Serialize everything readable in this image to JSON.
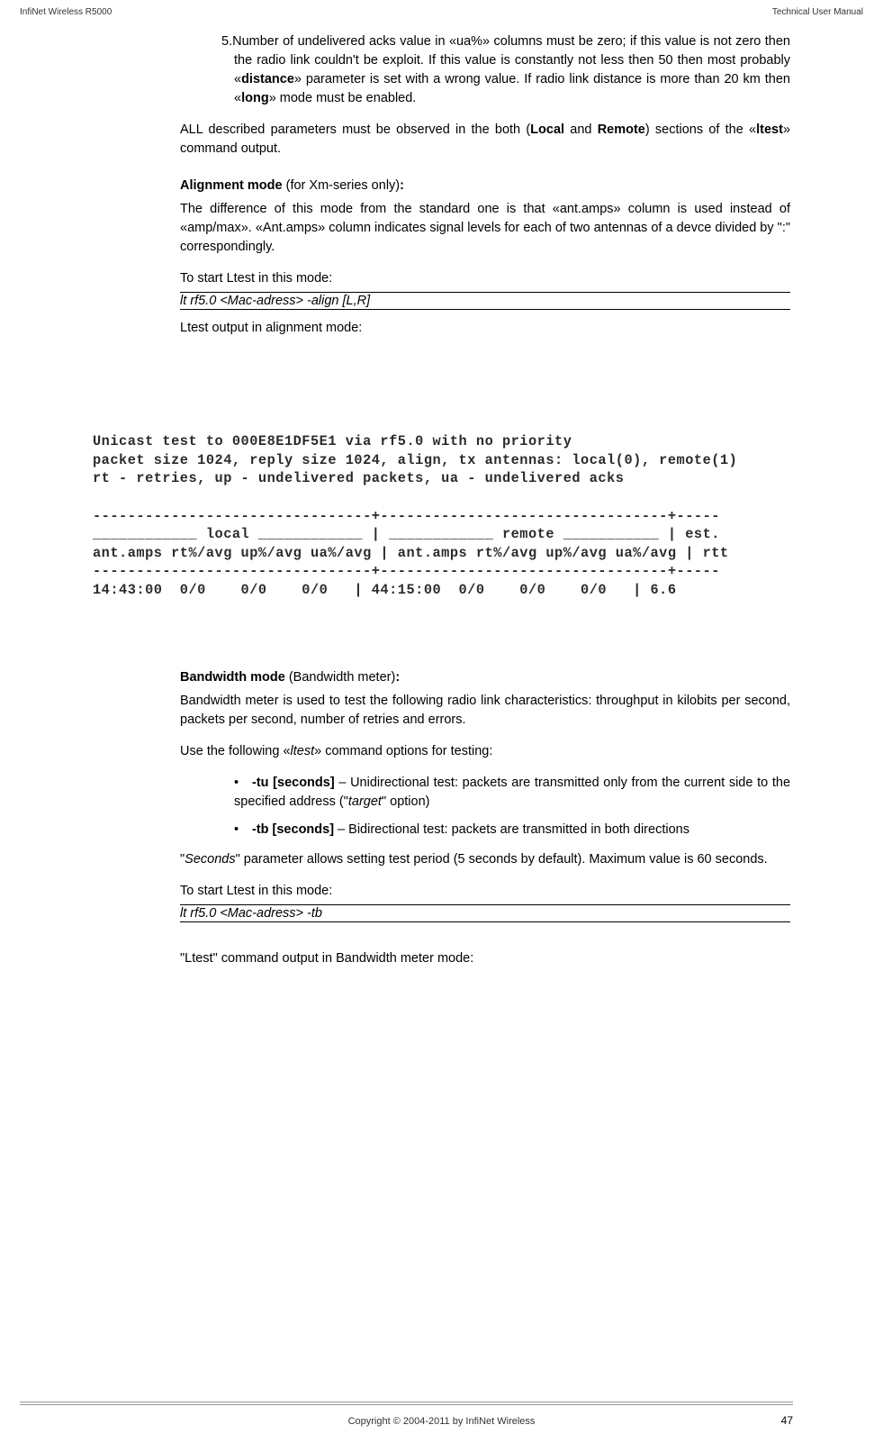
{
  "header": {
    "left": "InfiNet Wireless R5000",
    "right": "Technical User Manual"
  },
  "item5": {
    "num": "5.",
    "text_a": "Number of undelivered acks value in «ua%» columns must be zero; if this value is not zero then the radio link couldn't be exploit. If this value is constantly not less then 50 then most probably «",
    "kw1": "distance",
    "text_b": "» parameter is set with a wrong value. If radio link distance is more than 20 km then «",
    "kw2": "long",
    "text_c": "» mode must be enabled."
  },
  "all_desc": {
    "a": "ALL described parameters must be observed in the both (",
    "local": "Local",
    "and": " and ",
    "remote": "Remote",
    "b": ") sections of the «",
    "ltest": "ltest",
    "c": "» command output."
  },
  "align": {
    "title_b": "Alignment mode",
    "title_n": " (for Xm-series only)",
    "title_colon": ":",
    "p1": "The difference of this mode from the standard one is that «ant.amps» column is used instead of «amp/max». «Ant.amps» column indicates signal levels for each of two antennas of a devce divided by \":\" correspondingly.",
    "p2": " To start Ltest in this mode:",
    "cmd": "lt rf5.0 <Mac-adress> -align [L,R]",
    "p3": "Ltest output in alignment mode:"
  },
  "terminal_lines": [
    "Unicast test to 000E8E1DF5E1 via rf5.0 with no priority",
    "packet size 1024, reply size 1024, align, tx antennas: local(0), remote(1)",
    "rt - retries, up - undelivered packets, ua - undelivered acks",
    "",
    "--------------------------------+---------------------------------+-----",
    "____________ local ____________ | ____________ remote ___________ | est.",
    "ant.amps rt%/avg up%/avg ua%/avg | ant.amps rt%/avg up%/avg ua%/avg | rtt",
    "--------------------------------+---------------------------------+-----",
    "14:43:00  0/0    0/0    0/0   | 44:15:00  0/0    0/0    0/0   | 6.6"
  ],
  "bw": {
    "title_b": "Bandwidth mode",
    "title_n": " (Bandwidth meter)",
    "title_colon": ":",
    "p1": "Bandwidth meter is used to test the following radio link characteristics: throughput in kilobits per second, packets per second, number of retries and errors.",
    "p2_a": "Use the following «",
    "p2_i": "ltest",
    "p2_b": "» command options for testing:",
    "opts": [
      {
        "flag": "-tu [seconds]",
        "sep": " – ",
        "txt_a": "Unidirectional test: packets are transmitted only from the current side to the specified address (\"",
        "i": "target",
        "txt_b": "\" option)"
      },
      {
        "flag": "-tb [seconds]",
        "sep": " – ",
        "txt_a": "Bidirectional test: packets are transmitted in both directions",
        "i": "",
        "txt_b": ""
      }
    ],
    "p3_a": "\"",
    "p3_i": "Seconds",
    "p3_b": "\" parameter allows setting test period (5 seconds by default). Maximum value is 60 seconds.",
    "p4": "To start Ltest in this mode:",
    "cmd": "lt rf5.0 <Mac-adress> -tb",
    "p5": "\"Ltest\" command output in Bandwidth meter mode:"
  },
  "footer": {
    "copyright": "Copyright © 2004-2011 by InfiNet Wireless",
    "page": "47"
  }
}
